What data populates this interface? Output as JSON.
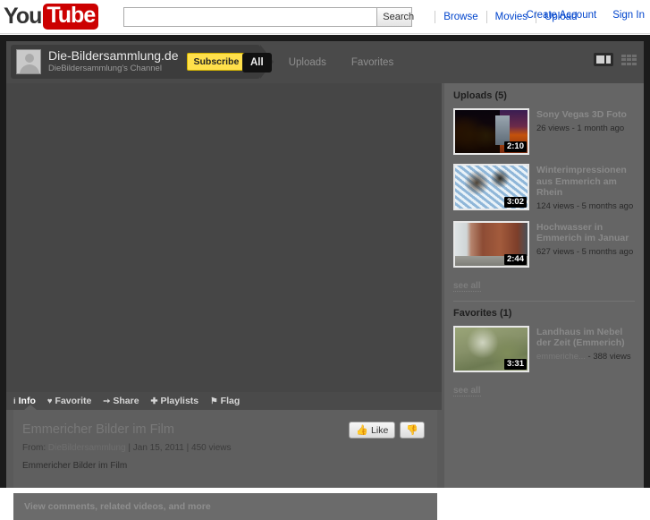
{
  "masthead": {
    "logo_you": "You",
    "logo_tube": "Tube",
    "search": {
      "value": "",
      "placeholder": ""
    },
    "search_button": "Search",
    "nav": [
      {
        "label": "Browse"
      },
      {
        "label": "Movies"
      },
      {
        "label": "Upload"
      }
    ],
    "account": [
      {
        "label": "Create Account"
      },
      {
        "label": "Sign In"
      }
    ],
    "link_color": "#0044cc",
    "brand_red": "#cc0000"
  },
  "channel": {
    "title": "Die-Bildersammlung.de",
    "subtitle": "DieBildersammlung's Channel",
    "subscribe_label": "Subscribe",
    "subscribe_color": "#ffe04b",
    "tabs": [
      {
        "label": "All",
        "active": true
      },
      {
        "label": "Uploads",
        "active": false
      },
      {
        "label": "Favorites",
        "active": false
      }
    ],
    "view_modes": [
      {
        "name": "theater-view"
      },
      {
        "name": "grid-view"
      }
    ]
  },
  "actions": [
    {
      "icon": "i",
      "label": "Info",
      "active": true
    },
    {
      "icon": "♥",
      "label": "Favorite",
      "active": false
    },
    {
      "icon": "➙",
      "label": "Share",
      "active": false
    },
    {
      "icon": "✚",
      "label": "Playlists",
      "active": false
    },
    {
      "icon": "⚑",
      "label": "Flag",
      "active": false
    }
  ],
  "video": {
    "title": "Emmericher Bilder im Film",
    "from_label": "From:",
    "uploader": "DieBildersammlung",
    "date": "Jan 15, 2011",
    "views": "450 views",
    "separator": " | ",
    "description": "Emmericher Bilder im Film",
    "like_label": "Like",
    "dislike_label": ""
  },
  "footer": {
    "link": "View comments, related videos, and more"
  },
  "sidebar": {
    "uploads": {
      "heading": "Uploads (5)",
      "see_all": "see all",
      "videos": [
        {
          "name": "Sony Vegas 3D Foto",
          "duration": "2:10",
          "views": "26 views",
          "age": "1 month ago",
          "stats": "26 views - 1 month ago",
          "art": "art-city"
        },
        {
          "name": "Winterimpressionen aus Emmerich am Rhein",
          "duration": "3:02",
          "views": "124 views",
          "age": "5 months ago",
          "stats": "124 views - 5 months ago",
          "art": "art-winter"
        },
        {
          "name": "Hochwasser in Emmerich im Januar",
          "duration": "2:44",
          "views": "627 views",
          "age": "5 months ago",
          "stats": "627 views - 5 months ago",
          "art": "art-brick"
        }
      ]
    },
    "favorites": {
      "heading": "Favorites (1)",
      "see_all": "see all",
      "videos": [
        {
          "name": "Landhaus im Nebel der Zeit (Emmerich)",
          "duration": "3:31",
          "channel": "emmeriche...",
          "views": "388 views",
          "stats_channel": "emmeriche...",
          "stats_views": " - 388 views",
          "art": "art-forest"
        }
      ]
    }
  }
}
